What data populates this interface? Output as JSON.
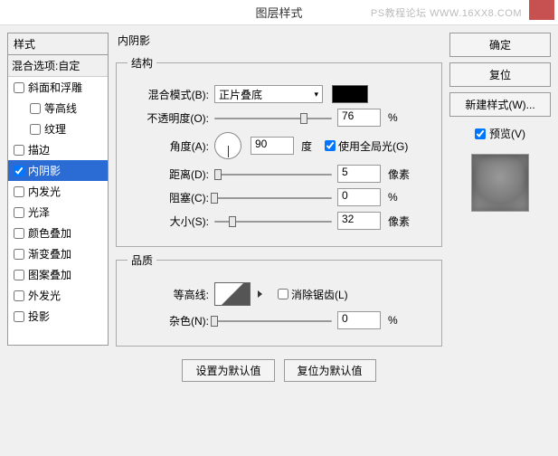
{
  "window": {
    "title": "图层样式"
  },
  "watermark": "PS教程论坛 WWW.16XX8.COM",
  "styles_panel": {
    "header": "样式",
    "blend_options": "混合选项:自定",
    "items": [
      {
        "label": "斜面和浮雕",
        "checked": false,
        "indent": false,
        "selected": false
      },
      {
        "label": "等高线",
        "checked": false,
        "indent": true,
        "selected": false
      },
      {
        "label": "纹理",
        "checked": false,
        "indent": true,
        "selected": false
      },
      {
        "label": "描边",
        "checked": false,
        "indent": false,
        "selected": false
      },
      {
        "label": "内阴影",
        "checked": true,
        "indent": false,
        "selected": true
      },
      {
        "label": "内发光",
        "checked": false,
        "indent": false,
        "selected": false
      },
      {
        "label": "光泽",
        "checked": false,
        "indent": false,
        "selected": false
      },
      {
        "label": "颜色叠加",
        "checked": false,
        "indent": false,
        "selected": false
      },
      {
        "label": "渐变叠加",
        "checked": false,
        "indent": false,
        "selected": false
      },
      {
        "label": "图案叠加",
        "checked": false,
        "indent": false,
        "selected": false
      },
      {
        "label": "外发光",
        "checked": false,
        "indent": false,
        "selected": false
      },
      {
        "label": "投影",
        "checked": false,
        "indent": false,
        "selected": false
      }
    ]
  },
  "main": {
    "title": "内阴影",
    "structure": {
      "legend": "结构",
      "blend_mode_label": "混合模式(B):",
      "blend_mode_value": "正片叠底",
      "opacity_label": "不透明度(O):",
      "opacity_value": "76",
      "opacity_unit": "%",
      "angle_label": "角度(A):",
      "angle_value": "90",
      "angle_unit": "度",
      "global_light_label": "使用全局光(G)",
      "distance_label": "距离(D):",
      "distance_value": "5",
      "distance_unit": "像素",
      "choke_label": "阻塞(C):",
      "choke_value": "0",
      "choke_unit": "%",
      "size_label": "大小(S):",
      "size_value": "32",
      "size_unit": "像素"
    },
    "quality": {
      "legend": "品质",
      "contour_label": "等高线:",
      "antialias_label": "消除锯齿(L)",
      "noise_label": "杂色(N):",
      "noise_value": "0",
      "noise_unit": "%"
    },
    "defaults": {
      "set_default": "设置为默认值",
      "reset_default": "复位为默认值"
    }
  },
  "right": {
    "ok": "确定",
    "cancel": "复位",
    "new_style": "新建样式(W)...",
    "preview_label": "预览(V)"
  }
}
